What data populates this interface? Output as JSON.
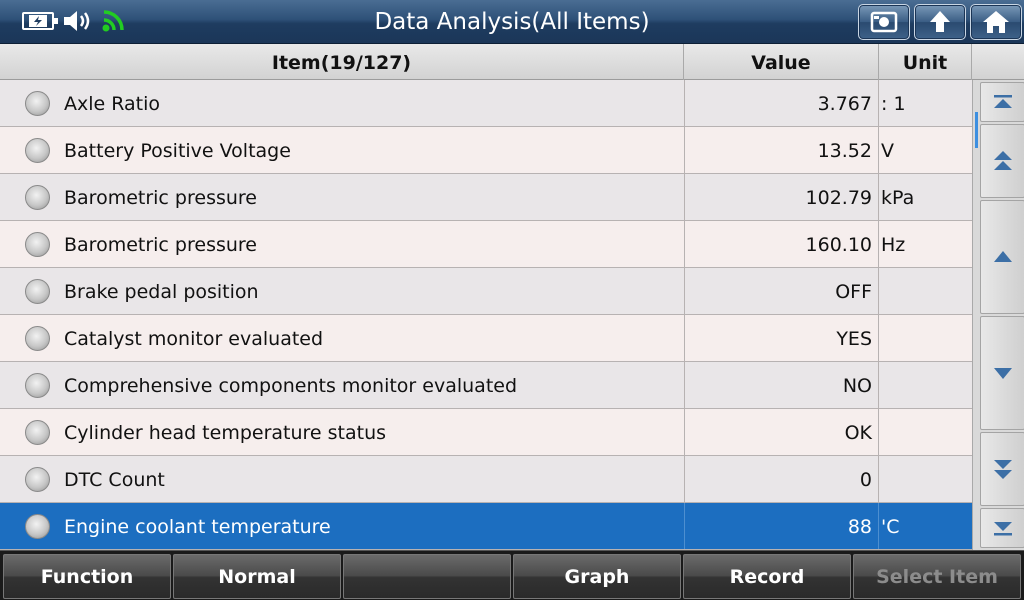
{
  "titlebar": {
    "title": "Data Analysis(All Items)",
    "icons": [
      "battery-charging-icon",
      "speaker-icon",
      "wifi-icon"
    ],
    "buttons": [
      "screenshot-icon",
      "back-icon",
      "home-icon"
    ]
  },
  "table": {
    "headers": {
      "item": "Item(19/127)",
      "value": "Value",
      "unit": "Unit"
    },
    "rows": [
      {
        "item": "Axle Ratio",
        "value": "3.767",
        "unit": ": 1"
      },
      {
        "item": "Battery Positive Voltage",
        "value": "13.52",
        "unit": "V"
      },
      {
        "item": "Barometric pressure",
        "value": "102.79",
        "unit": "kPa"
      },
      {
        "item": "Barometric pressure",
        "value": "160.10",
        "unit": "Hz"
      },
      {
        "item": "Brake pedal position",
        "value": "OFF",
        "unit": ""
      },
      {
        "item": "Catalyst monitor evaluated",
        "value": "YES",
        "unit": ""
      },
      {
        "item": "Comprehensive components monitor evaluated",
        "value": "NO",
        "unit": ""
      },
      {
        "item": "Cylinder head temperature status",
        "value": "OK",
        "unit": ""
      },
      {
        "item": "DTC Count",
        "value": "0",
        "unit": ""
      },
      {
        "item": "Engine coolant temperature",
        "value": "88",
        "unit": "'C",
        "selected": true
      }
    ]
  },
  "scroll_buttons": [
    "scroll-top-icon",
    "page-up-icon",
    "line-up-icon",
    "line-down-icon",
    "page-down-icon",
    "scroll-bottom-icon"
  ],
  "bottombar": {
    "function": "Function",
    "normal": "Normal",
    "blank": "",
    "graph": "Graph",
    "record": "Record",
    "select_item": "Select Item"
  },
  "colors": {
    "titlebar": "#2e5178",
    "selected_row": "#1c6ec0",
    "wifi": "#22cc22",
    "scroll_thumb": "#3d8fe0"
  }
}
